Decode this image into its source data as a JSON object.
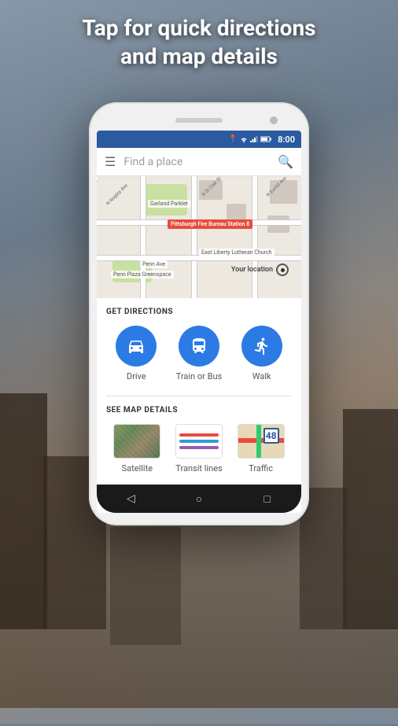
{
  "page": {
    "title_line1": "Tap for quick directions",
    "title_line2": "and map details"
  },
  "status_bar": {
    "time": "8:00"
  },
  "search": {
    "placeholder": "Find a place"
  },
  "map": {
    "location_label": "Your location"
  },
  "directions": {
    "section_title": "GET DIRECTIONS",
    "buttons": [
      {
        "id": "drive",
        "label": "Drive"
      },
      {
        "id": "transit",
        "label": "Train or Bus"
      },
      {
        "id": "walk",
        "label": "Walk"
      }
    ]
  },
  "map_details": {
    "section_title": "SEE MAP DETAILS",
    "items": [
      {
        "id": "satellite",
        "label": "Satellite"
      },
      {
        "id": "transit-lines",
        "label": "Transit lines"
      },
      {
        "id": "traffic",
        "label": "Traffic"
      }
    ]
  },
  "nav": {
    "back": "◁",
    "home": "○",
    "recent": "□"
  },
  "transit_lines": {
    "colors": [
      "#e74c3c",
      "#3498db",
      "#9b59b6"
    ]
  },
  "traffic_number": "48"
}
